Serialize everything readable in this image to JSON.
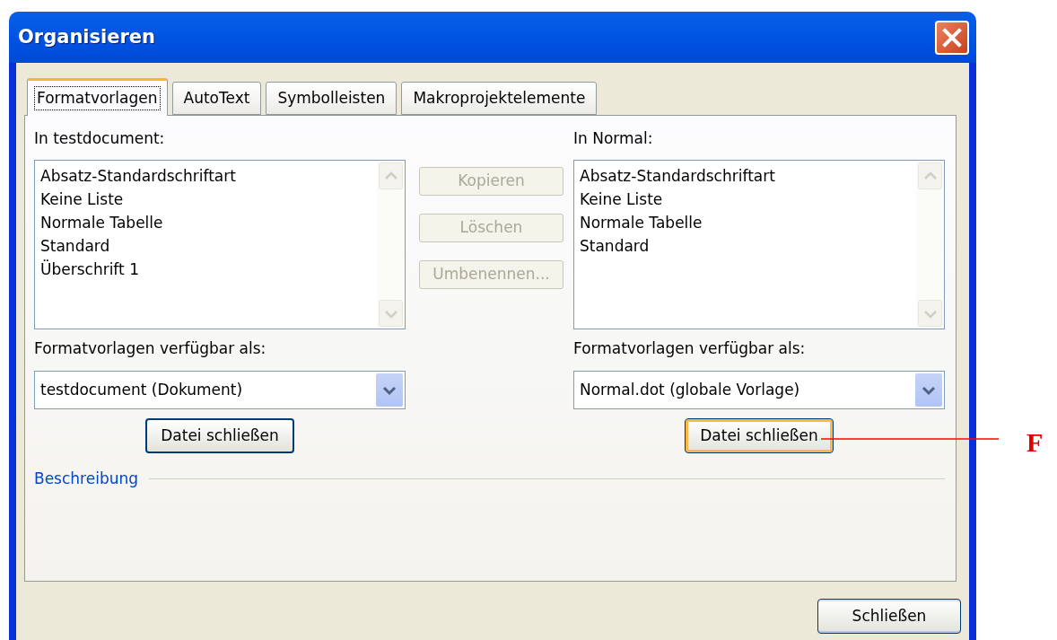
{
  "window": {
    "title": "Organisieren"
  },
  "tabs": [
    {
      "label": "Formatvorlagen",
      "selected": true
    },
    {
      "label": "AutoText",
      "selected": false
    },
    {
      "label": "Symbolleisten",
      "selected": false
    },
    {
      "label": "Makroprojektelemente",
      "selected": false
    }
  ],
  "left": {
    "label": "In testdocument:",
    "items": [
      "Absatz-Standardschriftart",
      "Keine Liste",
      "Normale Tabelle",
      "Standard",
      "Überschrift 1"
    ],
    "available_label": "Formatvorlagen verfügbar als:",
    "combo_value": "testdocument (Dokument)",
    "close_file_button": {
      "label": "Datei schließen",
      "focused": false
    }
  },
  "middle_buttons": [
    {
      "label": "Kopieren",
      "disabled": true
    },
    {
      "label": "Löschen",
      "disabled": true
    },
    {
      "label": "Umbenennen...",
      "disabled": true
    }
  ],
  "right": {
    "label": "In Normal:",
    "items": [
      "Absatz-Standardschriftart",
      "Keine Liste",
      "Normale Tabelle",
      "Standard"
    ],
    "available_label": "Formatvorlagen verfügbar als:",
    "combo_value": "Normal.dot (globale Vorlage)",
    "close_file_button": {
      "label": "Datei schließen",
      "focused": true
    }
  },
  "description_label": "Beschreibung",
  "close_button": "Schließen",
  "annotation": {
    "label": "F"
  }
}
